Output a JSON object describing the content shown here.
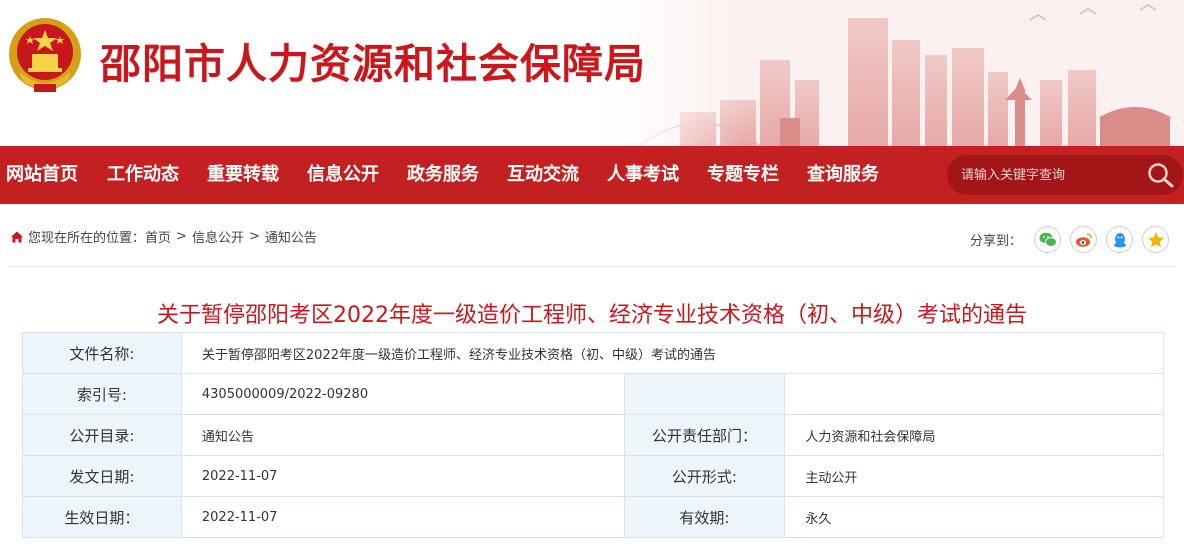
{
  "header": {
    "site_title": "邵阳市人力资源和社会保障局"
  },
  "nav": {
    "items": [
      {
        "label": "网站首页"
      },
      {
        "label": "工作动态"
      },
      {
        "label": "重要转载"
      },
      {
        "label": "信息公开"
      },
      {
        "label": "政务服务"
      },
      {
        "label": "互动交流"
      },
      {
        "label": "人事考试"
      },
      {
        "label": "专题专栏"
      },
      {
        "label": "查询服务"
      }
    ],
    "search_placeholder": "请输入关键字查询"
  },
  "breadcrumb": {
    "prefix": "您现在所在的位置：",
    "items": [
      "首页",
      "信息公开",
      "通知公告"
    ],
    "separator": ">"
  },
  "share": {
    "label": "分享到：",
    "icons": [
      "wechat-icon",
      "weibo-icon",
      "qq-icon",
      "qzone-icon"
    ]
  },
  "article": {
    "title": "关于暂停邵阳考区2022年度一级造价工程师、经济专业技术资格（初、中级）考试的通告",
    "info": {
      "file_name_label": "文件名称:",
      "file_name": "关于暂停邵阳考区2022年度一级造价工程师、经济专业技术资格（初、中级）考试的通告",
      "index_label": "索引号:",
      "index": "4305000009/2022-09280",
      "catalog_label": "公开目录:",
      "catalog": "通知公告",
      "dept_label": "公开责任部门：",
      "dept": "人力资源和社会保障局",
      "issue_date_label": "发文日期:",
      "issue_date": "2022-11-07",
      "form_label": "公开形式:",
      "form": "主动公开",
      "effective_label": "生效日期：",
      "effective_date": "2022-11-07",
      "validity_label": "有效期:",
      "validity": "永久"
    }
  },
  "colors": {
    "brand_red": "#c9171b",
    "nav_bg": "#c32121",
    "table_label_bg": "#eef5fa"
  }
}
